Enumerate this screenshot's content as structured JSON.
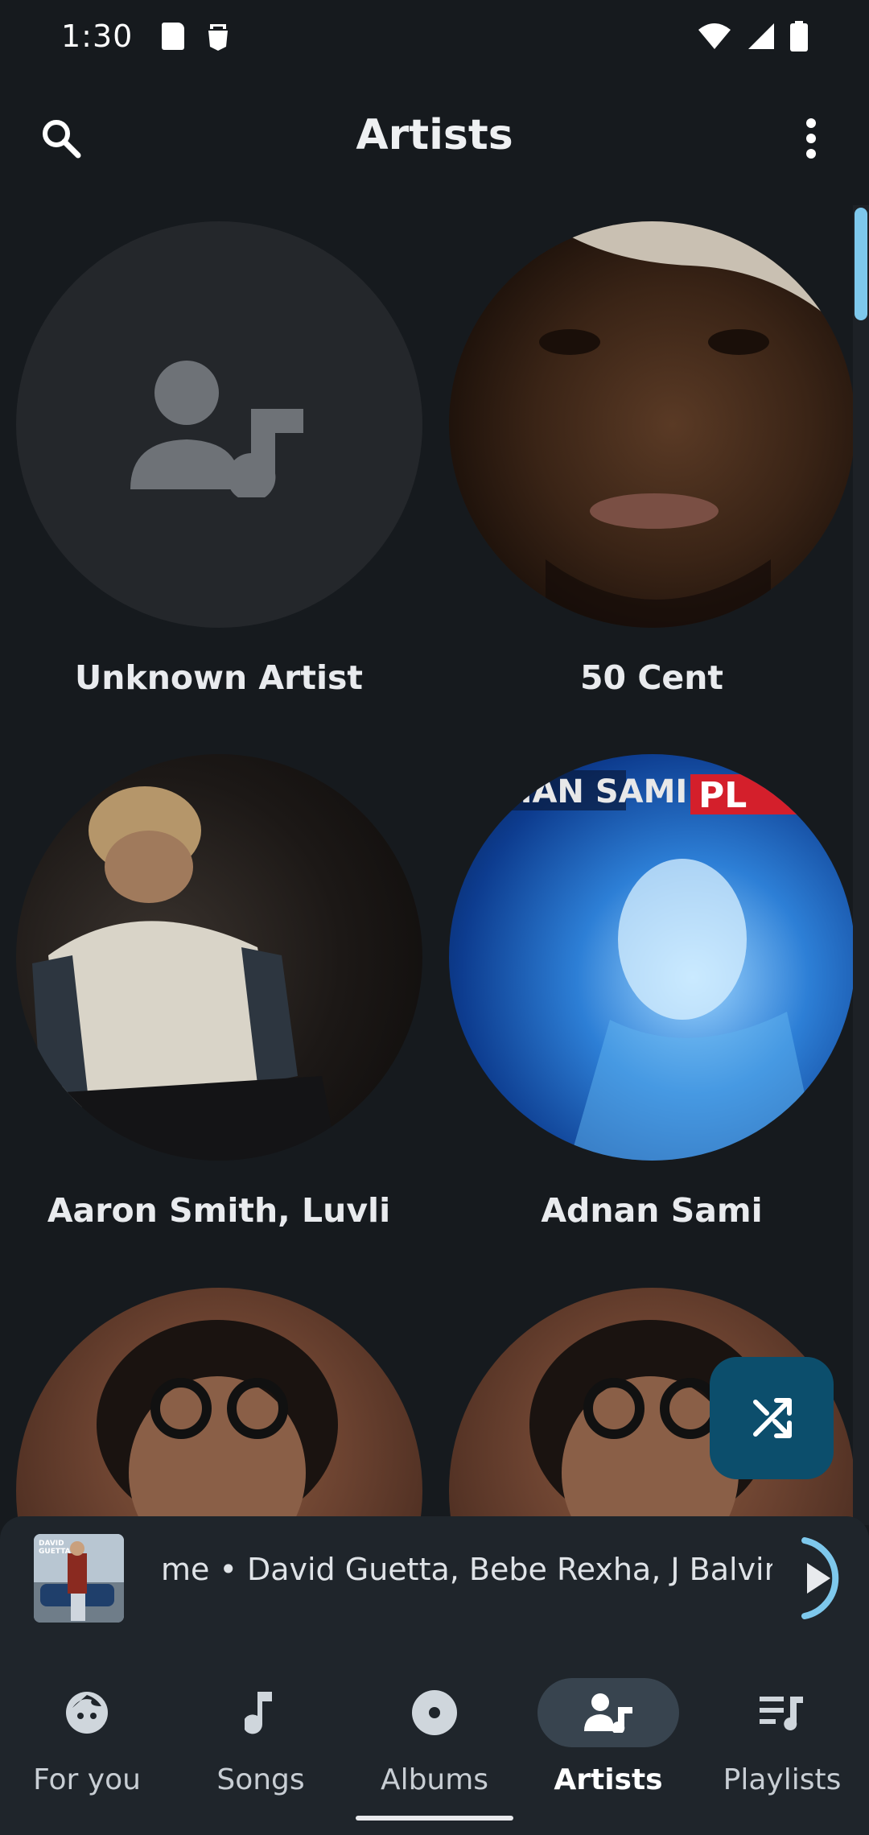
{
  "status_bar": {
    "time": "1:30"
  },
  "top_bar": {
    "title": "Artists"
  },
  "artists": [
    {
      "name": "Unknown Artist"
    },
    {
      "name": "50 Cent"
    },
    {
      "name": "Aaron Smith, Luvli"
    },
    {
      "name": "Adnan Sami"
    },
    {
      "name": ""
    },
    {
      "name": ""
    }
  ],
  "mini_player": {
    "text": "me • David Guetta, Bebe Rexha, J Balvin"
  },
  "bottom_nav": {
    "items": [
      {
        "label": "For you"
      },
      {
        "label": "Songs"
      },
      {
        "label": "Albums"
      },
      {
        "label": "Artists"
      },
      {
        "label": "Playlists"
      }
    ]
  },
  "colors": {
    "accent": "#7ec8ec",
    "fab": "#0c4e6c",
    "background": "#161a1e"
  }
}
